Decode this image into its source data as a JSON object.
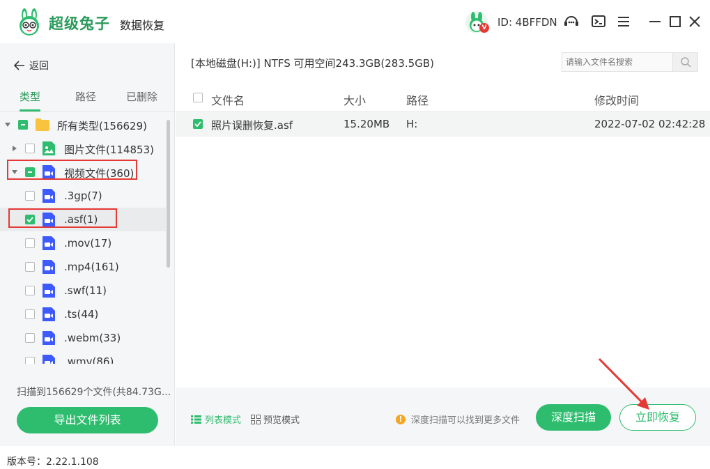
{
  "app": {
    "brand": "超级兔子",
    "subtitle": "数据恢复",
    "user_id": "ID: 4BFFDN",
    "badge": "V",
    "accent": "#2ebd6e"
  },
  "left": {
    "back_label": "返回",
    "tabs": [
      {
        "label": "类型",
        "active": true
      },
      {
        "label": "路径",
        "active": false
      },
      {
        "label": "已删除",
        "active": false
      }
    ],
    "tree": [
      {
        "label": "所有类型(156629)",
        "check": "partial",
        "icon": "folder-icon",
        "caret": "down"
      },
      {
        "label": "图片文件(114853)",
        "check": "none",
        "icon": "image-file-icon",
        "caret": "right"
      },
      {
        "label": "视频文件(360)",
        "check": "partial",
        "icon": "video-file-icon",
        "caret": "down"
      },
      {
        "label": ".3gp(7)",
        "check": "none",
        "icon": "video-file-icon"
      },
      {
        "label": ".asf(1)",
        "check": "checked",
        "icon": "video-file-icon"
      },
      {
        "label": ".mov(17)",
        "check": "none",
        "icon": "video-file-icon"
      },
      {
        "label": ".mp4(161)",
        "check": "none",
        "icon": "video-file-icon"
      },
      {
        "label": ".swf(11)",
        "check": "none",
        "icon": "video-file-icon"
      },
      {
        "label": ".ts(44)",
        "check": "none",
        "icon": "video-file-icon"
      },
      {
        "label": ".webm(33)",
        "check": "none",
        "icon": "video-file-icon"
      },
      {
        "label": ".wmv(86)",
        "check": "none",
        "icon": "video-file-icon"
      }
    ],
    "scan_summary": "扫描到156629个文件(共84.73G...",
    "export_label": "导出文件列表"
  },
  "version": "版本号：2.22.1.108",
  "main": {
    "disk_info": "[本地磁盘(H:)] NTFS 可用空间243.3GB(283.5GB)",
    "search_placeholder": "请输入文件名搜索",
    "columns": {
      "name": "文件名",
      "size": "大小",
      "path": "路径",
      "modified": "修改时间"
    },
    "rows": [
      {
        "name": "照片误删恢复.asf",
        "size": "15.20MB",
        "path": "H:",
        "modified": "2022-07-02 02:42:28",
        "checked": true
      }
    ],
    "list_mode": "列表模式",
    "preview_mode": "预览模式",
    "hint": "深度扫描可以找到更多文件",
    "deep_scan": "深度扫描",
    "recover_now": "立即恢复"
  }
}
